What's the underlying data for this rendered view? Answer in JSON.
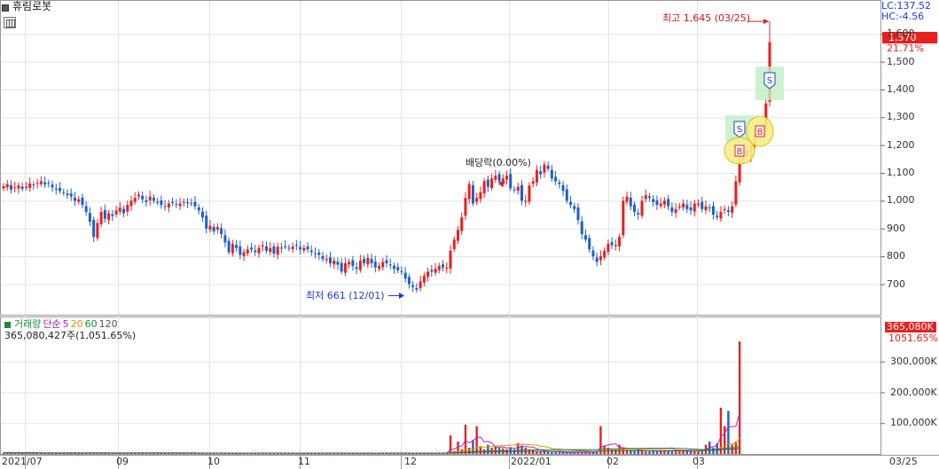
{
  "header": {
    "stock_name": "휴림로봇",
    "lc": "LC:137.52",
    "hc": "HC:-4.56",
    "current_price": "1,570",
    "current_change": "21.71%"
  },
  "annotations": {
    "high": "최고 1,645 (03/25)",
    "low": "최저 661 (12/01)",
    "dividend": "배당락(0.00%)"
  },
  "volume_panel": {
    "legend": [
      {
        "text": "거래량",
        "color": "#1a8a3a"
      },
      {
        "text": "단순",
        "color": "#a020a0"
      },
      {
        "text": "5",
        "color": "#c020c0"
      },
      {
        "text": "20",
        "color": "#d69a00"
      },
      {
        "text": "60",
        "color": "#1a8a3a"
      },
      {
        "text": "120",
        "color": "#555555"
      }
    ],
    "value": "365,080,427주(1,051.65%)",
    "current_volume": "365,080K",
    "current_pct": "1051.65%"
  },
  "colors": {
    "up": "#e8201e",
    "down": "#1c5fd0",
    "grid": "#e3e3e3"
  },
  "chart_data": {
    "type": "candlestick",
    "title": "휴림로봇",
    "price_axis": {
      "ticks": [
        700,
        800,
        900,
        1000,
        1100,
        1200,
        1300,
        1400,
        1500,
        1600
      ],
      "tick_labels": [
        "700",
        "800",
        "900",
        "1,000",
        "1,100",
        "1,200",
        "1,300",
        "1,400",
        "1,500",
        "1,600"
      ],
      "range": [
        590,
        1690
      ]
    },
    "volume_axis": {
      "ticks": [
        100000,
        200000,
        300000
      ],
      "tick_labels": [
        "100,000K",
        "200,000K",
        "300,000K"
      ],
      "range": [
        0,
        400000
      ]
    },
    "x_labels": [
      "2021/07",
      "09",
      "10",
      "11",
      "12",
      "2022/01",
      "02",
      "03",
      "03/25"
    ],
    "series": [
      {
        "name": "price",
        "values": [
          1052,
          1060,
          1040,
          1048,
          1055,
          1043,
          1050,
          1062,
          1056,
          1064,
          1070,
          1058,
          1062,
          1048,
          1040,
          1035,
          1030,
          1020,
          1015,
          1000,
          1005,
          985,
          960,
          925,
          870,
          920,
          960,
          935,
          955,
          945,
          965,
          975,
          955,
          985,
          1000,
          1010,
          1022,
          1005,
          995,
          1015,
          1000,
          995,
          985,
          980,
          990,
          992,
          985,
          990,
          995,
          995,
          990,
          980,
          965,
          940,
          900,
          910,
          890,
          905,
          880,
          850,
          815,
          845,
          830,
          805,
          815,
          825,
          825,
          815,
          830,
          840,
          820,
          830,
          810,
          835,
          830,
          835,
          830,
          835,
          838,
          825,
          830,
          825,
          815,
          808,
          805,
          790,
          790,
          775,
          785,
          770,
          745,
          775,
          780,
          765,
          755,
          785,
          775,
          795,
          775,
          760,
          765,
          780,
          775,
          770,
          755,
          750,
          745,
          720,
          700,
          690,
          680,
          710,
          730,
          745,
          745,
          755,
          765,
          760,
          760,
          820,
          860,
          895,
          940,
          1010,
          1060,
          990,
          1010,
          1030,
          1070,
          1050,
          1080,
          1090,
          1070,
          1080,
          1090,
          1045,
          1040,
          1050,
          1000,
          1000,
          1055,
          1070,
          1110,
          1095,
          1130,
          1115,
          1080,
          1070,
          1060,
          1035,
          1000,
          985,
          970,
          930,
          880,
          860,
          825,
          800,
          780,
          800,
          820,
          845,
          840,
          840,
          870,
          1000,
          1015,
          980,
          960,
          950,
          1000,
          1020,
          1010,
          995,
          985,
          990,
          1000,
          980,
          960,
          970,
          980,
          990,
          970,
          965,
          990,
          990,
          970,
          980,
          975,
          950,
          940,
          960,
          970,
          960,
          980,
          1070,
          1150,
          1180,
          1160,
          1200,
          1240,
          1250,
          1260,
          1350,
          1570
        ]
      },
      {
        "name": "volume",
        "values": [
          4000,
          3000,
          3500,
          3000,
          5000,
          3000,
          3000,
          4000,
          3000,
          3000,
          3000,
          3000,
          3000,
          2500,
          2500,
          3000,
          2500,
          2500,
          2500,
          3000,
          2500,
          3000,
          4000,
          3500,
          3000,
          3000,
          3000,
          3000,
          3000,
          3000,
          3000,
          3000,
          3000,
          3000,
          3000,
          3000,
          3000,
          3000,
          3000,
          3000,
          3000,
          3000,
          3000,
          3000,
          3000,
          3000,
          3000,
          3000,
          3000,
          3000,
          3000,
          3000,
          3000,
          3000,
          3000,
          3000,
          3000,
          3000,
          3000,
          3000,
          3000,
          3000,
          3000,
          3000,
          3000,
          3000,
          3000,
          3000,
          3000,
          3000,
          3000,
          3000,
          3000,
          3000,
          3000,
          3000,
          3000,
          3000,
          3000,
          3000,
          3000,
          3000,
          3000,
          3000,
          3000,
          3000,
          3000,
          3000,
          3000,
          3000,
          3000,
          3000,
          3000,
          3000,
          3000,
          3000,
          3000,
          3000,
          3000,
          3000,
          3000,
          3000,
          3000,
          3000,
          3000,
          3000,
          3000,
          3000,
          3000,
          3000,
          3000,
          3000,
          3000,
          3000,
          3000,
          3000,
          3000,
          3000,
          3000,
          60000,
          10000,
          40000,
          15000,
          95000,
          20000,
          45000,
          90000,
          25000,
          15000,
          30000,
          20000,
          25000,
          20000,
          18000,
          15000,
          22000,
          15000,
          35000,
          28000,
          20000,
          15000,
          12000,
          10000,
          8000,
          8000,
          7000,
          6000,
          5000,
          4000,
          5000,
          4000,
          4000,
          5000,
          6000,
          4000,
          6000,
          4000,
          4000,
          6000,
          90000,
          25000,
          20000,
          15000,
          15000,
          30000,
          20000,
          12000,
          10000,
          10000,
          15000,
          10000,
          8000,
          8000,
          10000,
          10000,
          8000,
          10000,
          12000,
          10000,
          8000,
          8000,
          10000,
          10000,
          8000,
          10000,
          10000,
          15000,
          30000,
          40000,
          20000,
          35000,
          150000,
          90000,
          140000,
          30000,
          40000,
          365080
        ]
      },
      {
        "name": "단순 5",
        "description": "5-period moving average of volume"
      }
    ]
  }
}
